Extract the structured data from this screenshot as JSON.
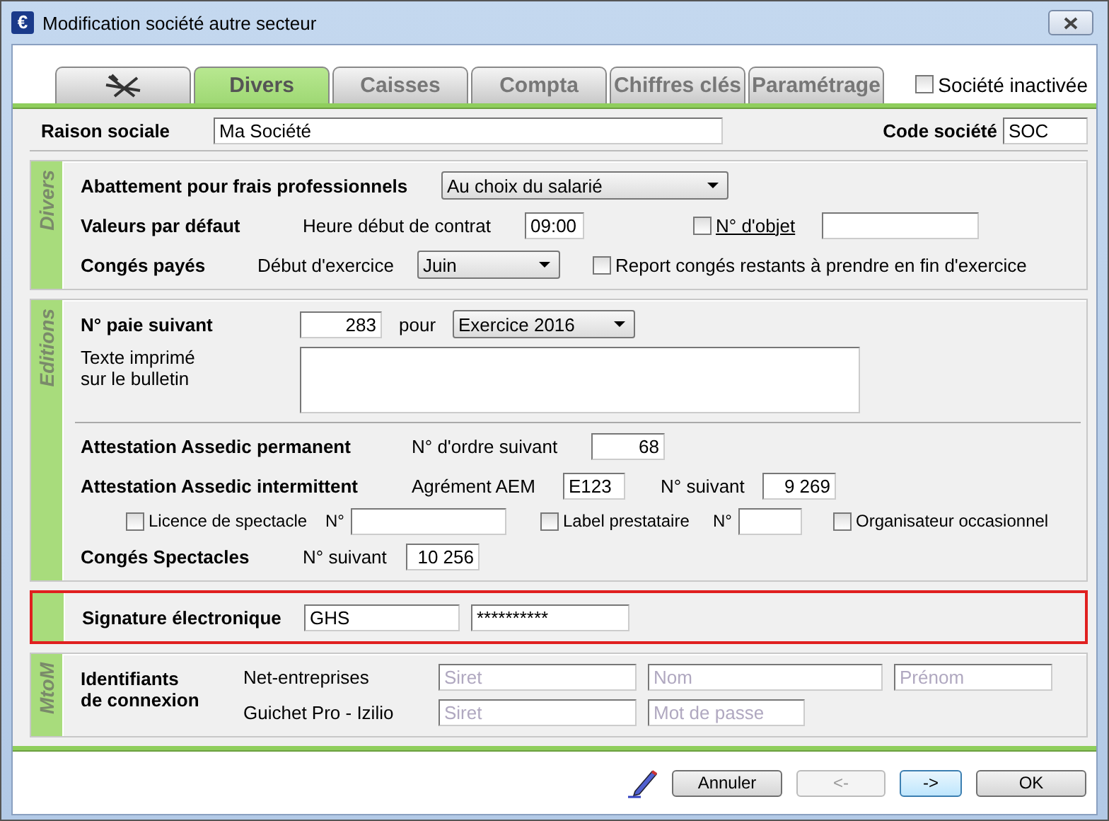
{
  "window": {
    "title": "Modification société autre secteur",
    "icon_glyph": "€"
  },
  "tabs": [
    {
      "kind": "icon",
      "selected": false
    },
    {
      "kind": "text",
      "label": "Divers",
      "selected": true
    },
    {
      "kind": "text",
      "label": "Caisses",
      "selected": false
    },
    {
      "kind": "text",
      "label": "Compta",
      "selected": false
    },
    {
      "kind": "text",
      "label": "Chiffres clés",
      "selected": false
    },
    {
      "kind": "text",
      "label": "Paramétrage",
      "selected": false
    }
  ],
  "inactive": {
    "label": "Société inactivée",
    "checked": false
  },
  "raison_sociale": {
    "label": "Raison sociale",
    "value": "Ma Société"
  },
  "code_societe": {
    "label": "Code société",
    "value": "SOC"
  },
  "divers": {
    "title": "Divers",
    "abattement": {
      "label": "Abattement pour frais professionnels",
      "value": "Au choix du salarié"
    },
    "valeurs": {
      "label": "Valeurs par défaut",
      "heure_label": "Heure début de contrat",
      "heure_value": "09:00",
      "objet": {
        "label": "N° d'objet",
        "checked": false
      }
    },
    "conges": {
      "label": "Congés payés",
      "debut_label": "Début d'exercice",
      "debut_value": "Juin",
      "report": {
        "label": "Report congés restants à prendre en fin d'exercice",
        "checked": false
      }
    }
  },
  "editions": {
    "title": "Editions",
    "paie": {
      "label": "N° paie suivant",
      "value": "283",
      "pour": "pour",
      "exercice": "Exercice 2016"
    },
    "texte_label": "Texte imprimé\nsur le bulletin",
    "permanent": {
      "label": "Attestation Assedic permanent",
      "ordre_label": "N° d'ordre suivant",
      "ordre_value": "68"
    },
    "intermittent": {
      "label": "Attestation Assedic intermittent",
      "aem_label": "Agrément AEM",
      "aem_value": "E123",
      "suivant_label": "N° suivant",
      "suivant_value": "9 269"
    },
    "options": [
      {
        "label": "Licence de spectacle",
        "checked": false,
        "no_label": "N°"
      },
      {
        "label": "Label prestataire",
        "checked": false,
        "no_label": "N°"
      },
      {
        "label": "Organisateur occasionnel",
        "checked": false
      }
    ],
    "spectacles": {
      "label": "Congés Spectacles",
      "suivant_label": "N° suivant",
      "suivant_value": "10 256"
    }
  },
  "signature": {
    "label": "Signature électronique",
    "value": "GHS",
    "password": "**********"
  },
  "mtom": {
    "title": "MtoM",
    "label": "Identifiants\nde connexion",
    "rows": [
      {
        "label": "Net-entreprises",
        "fields": [
          {
            "placeholder": "Siret"
          },
          {
            "placeholder": "Nom"
          },
          {
            "placeholder": "Prénom"
          }
        ]
      },
      {
        "label": "Guichet Pro - Izilio",
        "fields": [
          {
            "placeholder": "Siret"
          },
          {
            "placeholder": "Mot de passe"
          }
        ]
      }
    ]
  },
  "buttons": [
    {
      "label": "Annuler",
      "disabled": false,
      "focused": false
    },
    {
      "label": "<-",
      "disabled": true,
      "focused": false
    },
    {
      "label": "->",
      "disabled": false,
      "focused": true
    },
    {
      "label": "OK",
      "disabled": false,
      "focused": false
    }
  ]
}
